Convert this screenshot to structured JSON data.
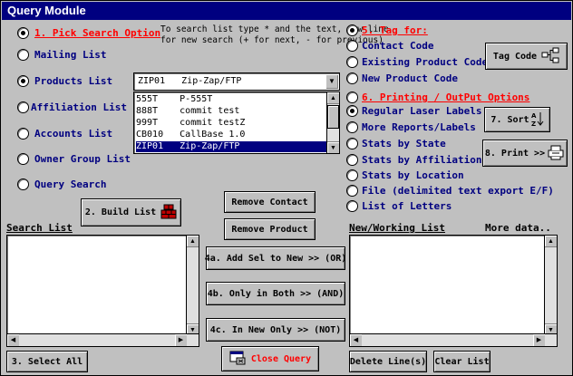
{
  "window": {
    "title": "Query Module"
  },
  "search_options": {
    "heading": "1. Pick Search Option",
    "hint_line1": "To search list type * and the text, new line",
    "hint_line2": "for new search (+ for next, - for previous)",
    "items": [
      {
        "label": "Mailing List",
        "selected": false
      },
      {
        "label": "Products List",
        "selected": true
      },
      {
        "label": "Affiliation List",
        "selected": false
      },
      {
        "label": "Accounts List",
        "selected": false
      },
      {
        "label": "Owner Group List",
        "selected": false
      },
      {
        "label": "Query Search",
        "selected": false
      }
    ]
  },
  "products_combo": {
    "selected": "ZIP01   Zip-Zap/FTP",
    "options": [
      "555T    P-555T",
      "888T    commit test",
      "999T    commit testZ",
      "CB010   CallBase 1.0",
      "ZIP01   Zip-Zap/FTP"
    ],
    "selected_index": 4
  },
  "tag_for": {
    "heading": "5. Tag for:",
    "items": [
      {
        "label": "Contact Code",
        "selected": false
      },
      {
        "label": "Existing Product Code",
        "selected": false
      },
      {
        "label": "New Product Code",
        "selected": false
      }
    ],
    "tag_code_button": "Tag Code"
  },
  "printing": {
    "heading": "6. Printing / OutPut Options",
    "items": [
      {
        "label": "Regular Laser Labels",
        "selected": true
      },
      {
        "label": "More Reports/Labels",
        "selected": false
      },
      {
        "label": "Stats by State",
        "selected": false
      },
      {
        "label": "Stats by Affiliation",
        "selected": false
      },
      {
        "label": "Stats by Location",
        "selected": false
      },
      {
        "label": "File (delimited text export E/F)",
        "selected": false
      },
      {
        "label": "List of Letters",
        "selected": false
      }
    ],
    "sort_button": "7. Sort",
    "print_button": "8. Print >>"
  },
  "buttons": {
    "build_list": "2. Build List",
    "remove_contact": "Remove Contact",
    "remove_product": "Remove Product",
    "add_sel": "4a. Add Sel to New >> (OR)",
    "only_both": "4b. Only in Both >> (AND)",
    "in_new_only": "4c. In New Only >> (NOT)",
    "select_all": "3. Select All",
    "close_query": "Close Query",
    "delete_lines": "Delete Line(s)",
    "clear_list": "Clear List"
  },
  "search_list": {
    "label": "Search List"
  },
  "new_list": {
    "label": "New/Working List",
    "more": "More data.."
  },
  "colors": {
    "titlebar": "#000080",
    "label": "#000080",
    "heading": "#ff0000",
    "face": "#c0c0c0"
  }
}
